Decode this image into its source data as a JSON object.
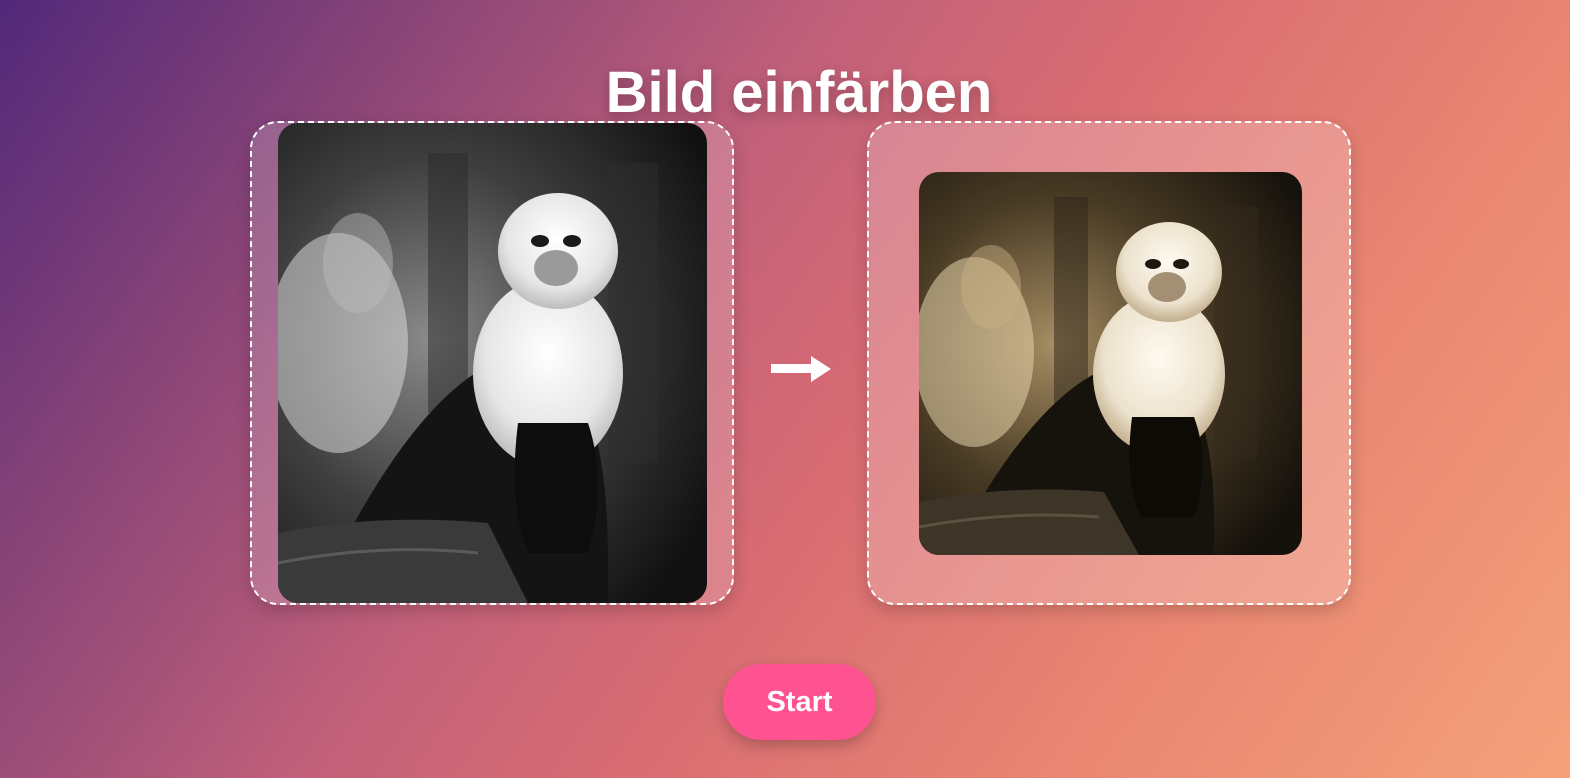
{
  "page": {
    "title": "Bild einfärben"
  },
  "images": {
    "source": {
      "description_icon": "image-grayscale",
      "style": "grayscale"
    },
    "result": {
      "description_icon": "image-colorized",
      "style": "colorized"
    },
    "arrow_icon": "arrow-right-icon"
  },
  "actions": {
    "start_label": "Start"
  },
  "colors": {
    "accent": "#ff5291",
    "frame_border": "#ffffff",
    "gradient_start": "#52287a",
    "gradient_end": "#f4a17a"
  }
}
